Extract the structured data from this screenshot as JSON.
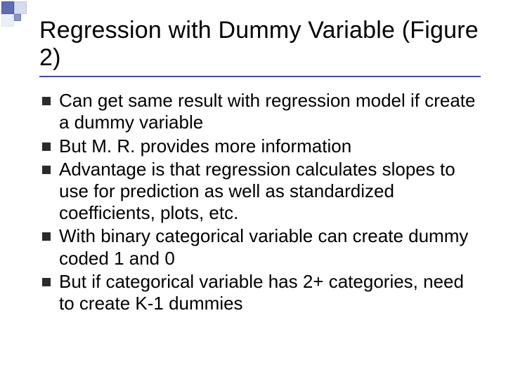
{
  "slide": {
    "title": "Regression with Dummy Variable (Figure 2)",
    "bullets": [
      "Can get same result with regression model if create a dummy variable",
      "But M. R. provides more information",
      "Advantage is that regression calculates slopes to use for prediction as well as standardized coefficients, plots, etc.",
      "With binary categorical variable can create dummy coded 1 and 0",
      "But if categorical variable has 2+ categories, need to create K-1 dummies"
    ]
  }
}
